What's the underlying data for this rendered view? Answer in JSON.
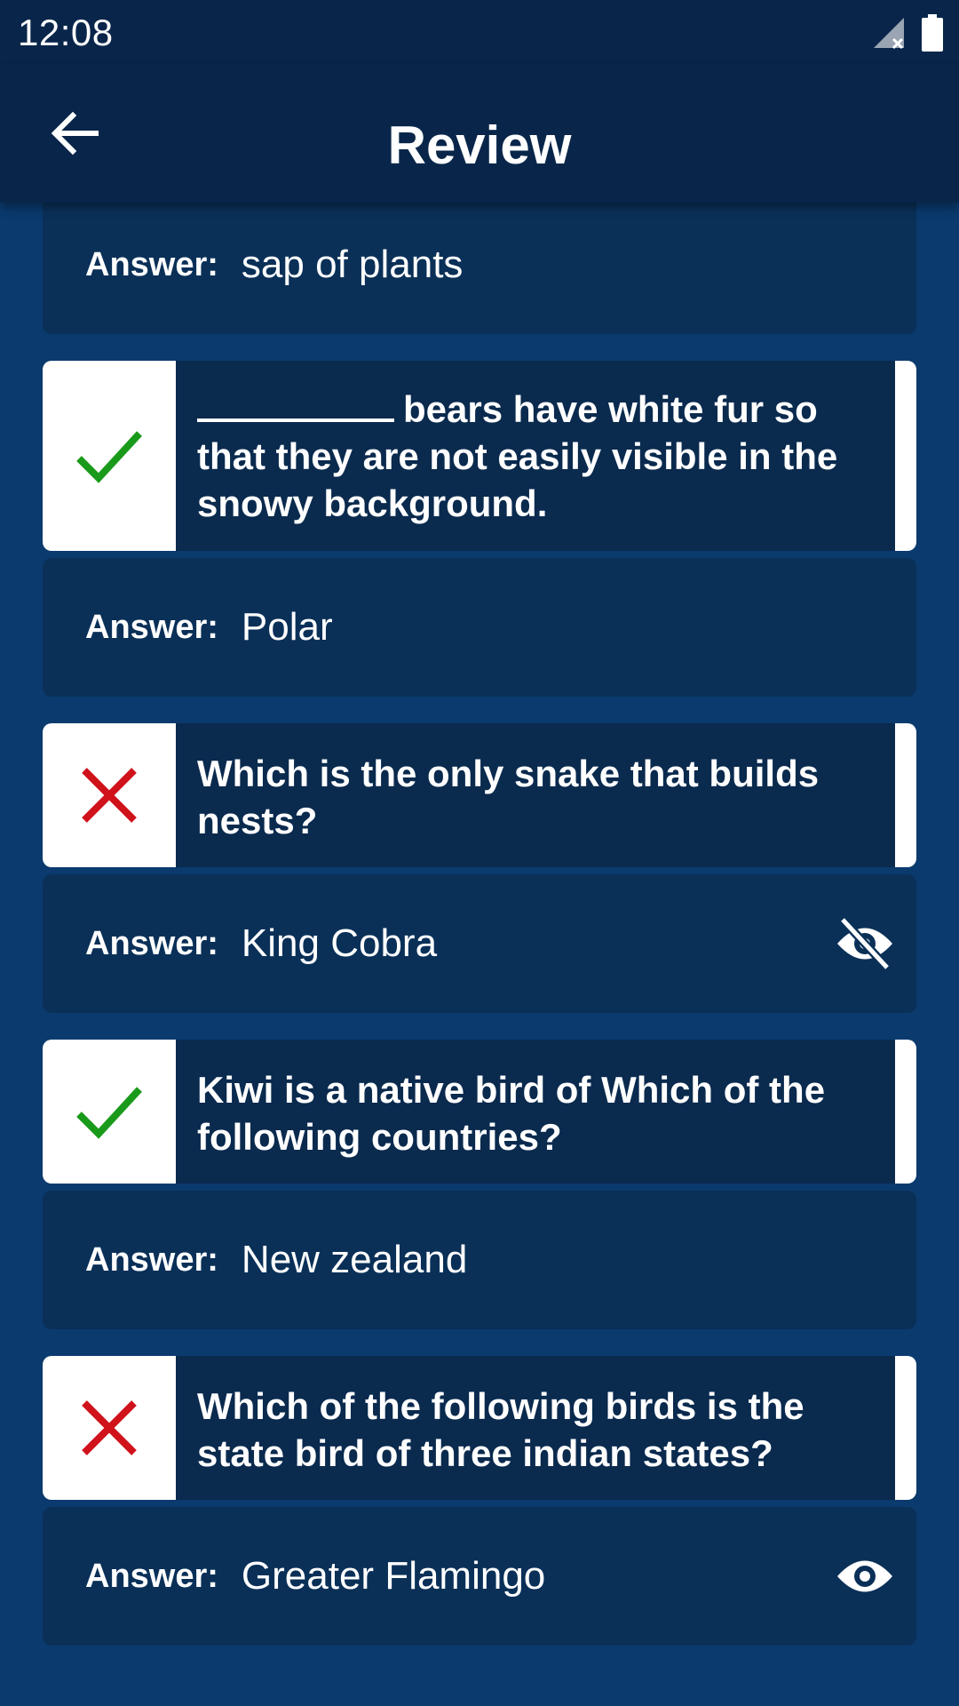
{
  "status_bar": {
    "time": "12:08"
  },
  "app_bar": {
    "title": "Review"
  },
  "answer_label": "Answer:",
  "colors": {
    "correct": "#1a9a1a",
    "wrong": "#d0121b",
    "background": "#0a3a6e"
  },
  "items": [
    {
      "question": "",
      "result": "partial",
      "answer": "sap of plants",
      "eye": "none"
    },
    {
      "question": "bears have white fur so that they are not easily visible in the snowy background.",
      "has_blank": true,
      "result": "correct",
      "answer": "Polar",
      "eye": "none"
    },
    {
      "question": "Which is the only snake that builds nests?",
      "result": "wrong",
      "answer": "King Cobra",
      "eye": "eye-off-icon"
    },
    {
      "question": "Kiwi is a native bird of Which of the following countries?",
      "result": "correct",
      "answer": "New zealand",
      "eye": "none"
    },
    {
      "question": "Which of the following birds is the state bird of three indian states?",
      "result": "wrong",
      "answer": "Greater Flamingo",
      "eye": "eye-icon"
    }
  ]
}
